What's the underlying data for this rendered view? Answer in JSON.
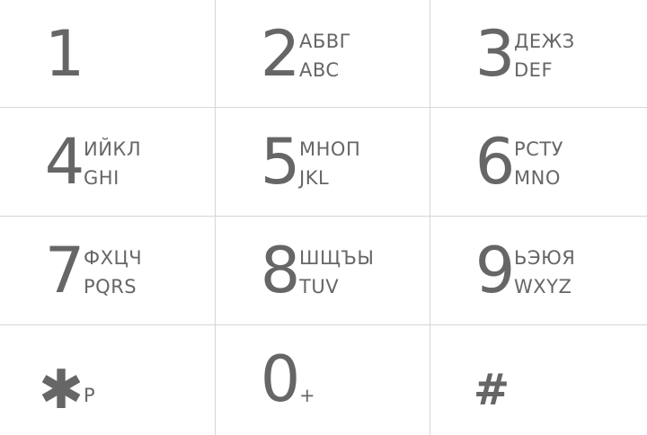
{
  "keypad": {
    "keys": [
      {
        "digit": "1",
        "cyrillic": "",
        "latin": ""
      },
      {
        "digit": "2",
        "cyrillic": "АБВГ",
        "latin": "ABC"
      },
      {
        "digit": "3",
        "cyrillic": "ДЕЖЗ",
        "latin": "DEF"
      },
      {
        "digit": "4",
        "cyrillic": "ИЙКЛ",
        "latin": "GHI"
      },
      {
        "digit": "5",
        "cyrillic": "МНОП",
        "latin": "JKL"
      },
      {
        "digit": "6",
        "cyrillic": "РСТУ",
        "latin": "MNO"
      },
      {
        "digit": "7",
        "cyrillic": "ФХЦЧ",
        "latin": "PQRS"
      },
      {
        "digit": "8",
        "cyrillic": "ШЩЪЫ",
        "latin": "TUV"
      },
      {
        "digit": "9",
        "cyrillic": "ЬЭЮЯ",
        "latin": "WXYZ"
      }
    ],
    "star": {
      "symbol": "✱",
      "sub": "P"
    },
    "zero": {
      "digit": "0",
      "sub": "+"
    },
    "hash": {
      "symbol": "#"
    }
  },
  "colors": {
    "text": "#666666",
    "divider": "#d6d6d6",
    "background": "#ffffff"
  }
}
